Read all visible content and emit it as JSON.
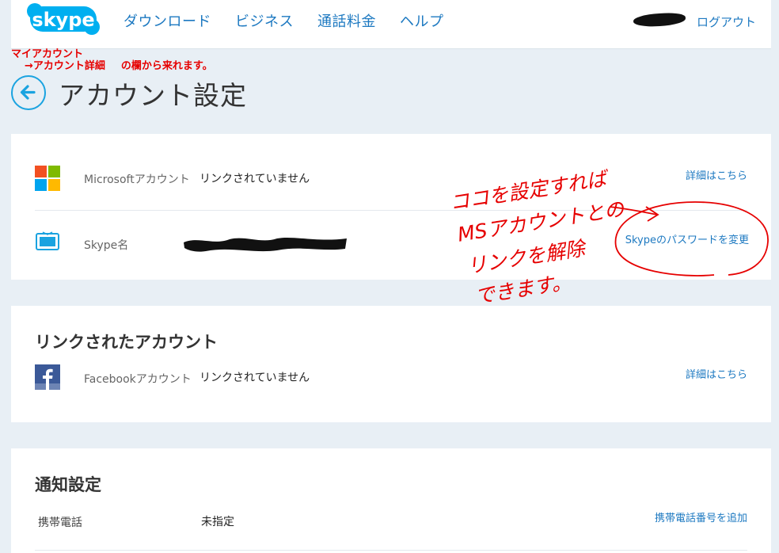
{
  "header": {
    "logo_text": "skype",
    "nav": [
      "ダウンロード",
      "ビジネス",
      "通話料金",
      "ヘルプ"
    ],
    "logout": "ログアウト"
  },
  "note": {
    "line1": "マイアカウント",
    "line2a": "→アカウント詳細",
    "line2b": "の欄から来れます。"
  },
  "page": {
    "title": "アカウント設定"
  },
  "account_section": {
    "rows": [
      {
        "icon": "microsoft-logo-icon",
        "label": "Microsoftアカウント",
        "value": "リンクされていません",
        "link": "詳細はこちら"
      },
      {
        "icon": "tv-screen-icon",
        "label": "Skype名",
        "value": "",
        "link": "Skypeのパスワードを変更"
      }
    ]
  },
  "linked_section": {
    "title": "リンクされたアカウント",
    "rows": [
      {
        "icon": "facebook-icon",
        "label": "Facebookアカウント",
        "value": "リンクされていません",
        "link": "詳細はこちら"
      }
    ]
  },
  "notify_section": {
    "title": "通知設定",
    "rows": [
      {
        "label": "携帯電話",
        "value": "未指定",
        "link": "携帯電話番号を追加"
      }
    ]
  },
  "annotation": {
    "lines": [
      "ココを設定すれば",
      "MSアカウントとの",
      "リンクを解除",
      "できます。"
    ],
    "color": "#e60000"
  },
  "colors": {
    "accent": "#1d79c1",
    "skype_blue": "#00aff0",
    "background": "#e8eff5"
  }
}
